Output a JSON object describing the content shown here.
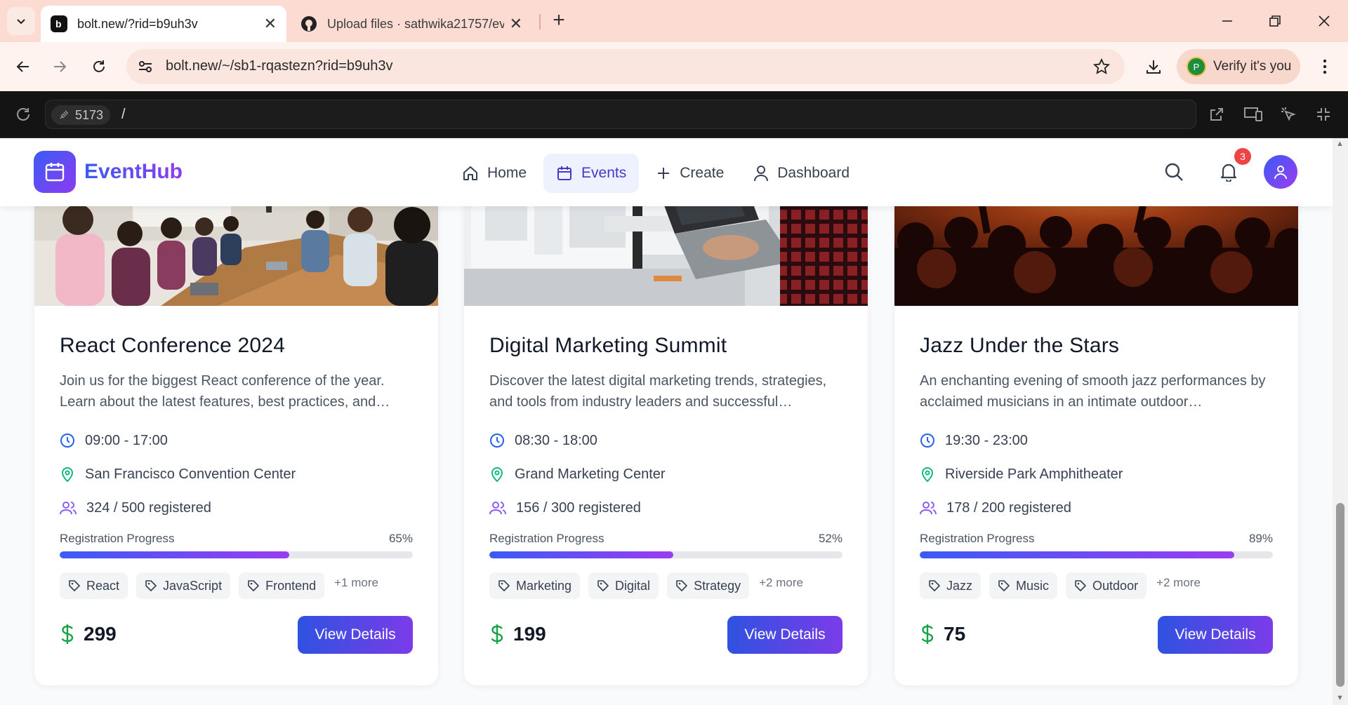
{
  "browser": {
    "tabs": [
      {
        "title": "bolt.new/?rid=b9uh3v",
        "active": true
      },
      {
        "title": "Upload files · sathwika21757/ev",
        "active": false
      }
    ],
    "url": "bolt.new/~/sb1-rqastezn?rid=b9uh3v",
    "verify_label": "Verify it's you",
    "profile_initial": "P"
  },
  "preview": {
    "port": "5173",
    "path": "/"
  },
  "header": {
    "brand": "EventHub",
    "nav": [
      {
        "label": "Home",
        "icon": "home-icon"
      },
      {
        "label": "Events",
        "icon": "calendar-icon",
        "active": true
      },
      {
        "label": "Create",
        "icon": "plus-icon"
      },
      {
        "label": "Dashboard",
        "icon": "user-icon"
      }
    ],
    "notification_count": "3"
  },
  "colors": {
    "brand_start": "#3b5bf5",
    "brand_end": "#8b3cf0",
    "clock_icon": "#2563eb",
    "location_icon": "#10b981",
    "users_icon": "#8b5cf6",
    "price_icon": "#16a34a"
  },
  "events": [
    {
      "title": "React Conference 2024",
      "description": "Join us for the biggest React conference of the year. Learn about the latest features, best practices, and…",
      "time": "09:00 - 17:00",
      "location": "San Francisco Convention Center",
      "registered": "324 / 500 registered",
      "progress_label": "Registration Progress",
      "progress_text": "65%",
      "progress": 0.65,
      "tags": [
        "React",
        "JavaScript",
        "Frontend"
      ],
      "more": "+1 more",
      "price": "299",
      "cta": "View Details"
    },
    {
      "title": "Digital Marketing Summit",
      "description": "Discover the latest digital marketing trends, strategies, and tools from industry leaders and successful…",
      "time": "08:30 - 18:00",
      "location": "Grand Marketing Center",
      "registered": "156 / 300 registered",
      "progress_label": "Registration Progress",
      "progress_text": "52%",
      "progress": 0.52,
      "tags": [
        "Marketing",
        "Digital",
        "Strategy"
      ],
      "more": "+2 more",
      "price": "199",
      "cta": "View Details"
    },
    {
      "title": "Jazz Under the Stars",
      "description": "An enchanting evening of smooth jazz performances by acclaimed musicians in an intimate outdoor…",
      "time": "19:30 - 23:00",
      "location": "Riverside Park Amphitheater",
      "registered": "178 / 200 registered",
      "progress_label": "Registration Progress",
      "progress_text": "89%",
      "progress": 0.89,
      "tags": [
        "Jazz",
        "Music",
        "Outdoor"
      ],
      "more": "+2 more",
      "price": "75",
      "cta": "View Details"
    }
  ]
}
